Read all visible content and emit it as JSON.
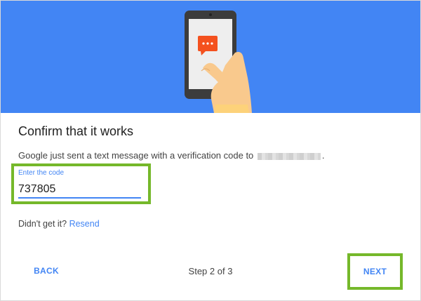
{
  "header": {
    "illustration": "phone-with-message-icon",
    "background_color": "#4285f4"
  },
  "title": "Confirm that it works",
  "description": {
    "prefix": "Google just sent a text message with a verification code to",
    "suffix": "."
  },
  "code_input": {
    "label": "Enter the code",
    "value": "737805"
  },
  "resend": {
    "prefix": "Didn't get it?",
    "link": "Resend"
  },
  "footer": {
    "back_label": "BACK",
    "step_text": "Step 2 of 3",
    "next_label": "NEXT"
  },
  "colors": {
    "accent": "#4285f4",
    "highlight": "#75b82a",
    "chat_bubble": "#f4511e"
  }
}
